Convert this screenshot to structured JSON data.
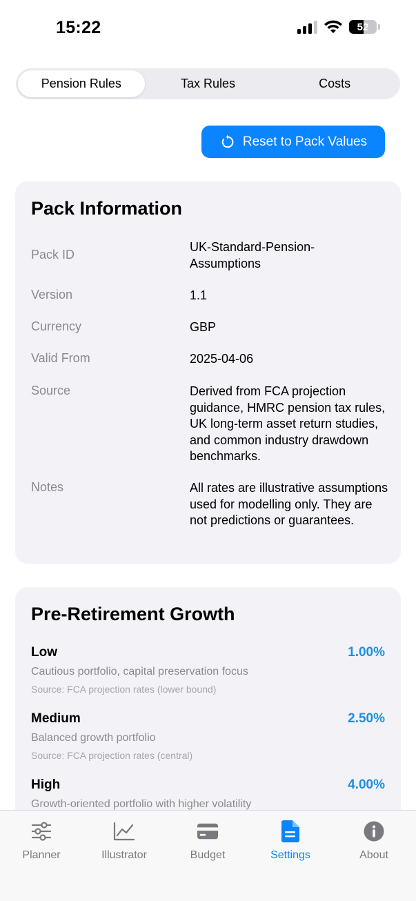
{
  "status_bar": {
    "time": "15:22",
    "battery": "52"
  },
  "tabs_segment": [
    {
      "label": "Pension Rules",
      "active": true
    },
    {
      "label": "Tax Rules",
      "active": false
    },
    {
      "label": "Costs",
      "active": false
    }
  ],
  "reset_button": {
    "label": "Reset to Pack Values"
  },
  "pack_info": {
    "title": "Pack Information",
    "rows": [
      {
        "label": "Pack ID",
        "value": "UK-Standard-Pension-Assumptions"
      },
      {
        "label": "Version",
        "value": "1.1"
      },
      {
        "label": "Currency",
        "value": "GBP"
      },
      {
        "label": "Valid From",
        "value": "2025-04-06"
      },
      {
        "label": "Source",
        "value": "Derived from FCA projection guidance, HMRC pension tax rules, UK long-term asset return studies, and common industry drawdown benchmarks."
      },
      {
        "label": "Notes",
        "value": "All rates are illustrative assumptions used for modelling only. They are not predictions or guarantees."
      }
    ]
  },
  "growth": {
    "title": "Pre-Retirement Growth",
    "items": [
      {
        "name": "Low",
        "rate": "1.00%",
        "description": "Cautious portfolio, capital preservation focus",
        "source": "Source: FCA projection rates (lower bound)"
      },
      {
        "name": "Medium",
        "rate": "2.50%",
        "description": "Balanced growth portfolio",
        "source": "Source: FCA projection rates (central)"
      },
      {
        "name": "High",
        "rate": "4.00%",
        "description": "Growth-oriented portfolio with higher volatility",
        "source": ""
      }
    ]
  },
  "tab_bar": [
    {
      "label": "Planner",
      "icon": "sliders-icon",
      "active": false
    },
    {
      "label": "Illustrator",
      "icon": "chart-line-icon",
      "active": false
    },
    {
      "label": "Budget",
      "icon": "card-icon",
      "active": false
    },
    {
      "label": "Settings",
      "icon": "document-icon",
      "active": true
    },
    {
      "label": "About",
      "icon": "info-icon",
      "active": false
    }
  ],
  "colors": {
    "accent": "#0a84ff",
    "rate": "#1a8fe0",
    "card": "#f2f2f7"
  }
}
